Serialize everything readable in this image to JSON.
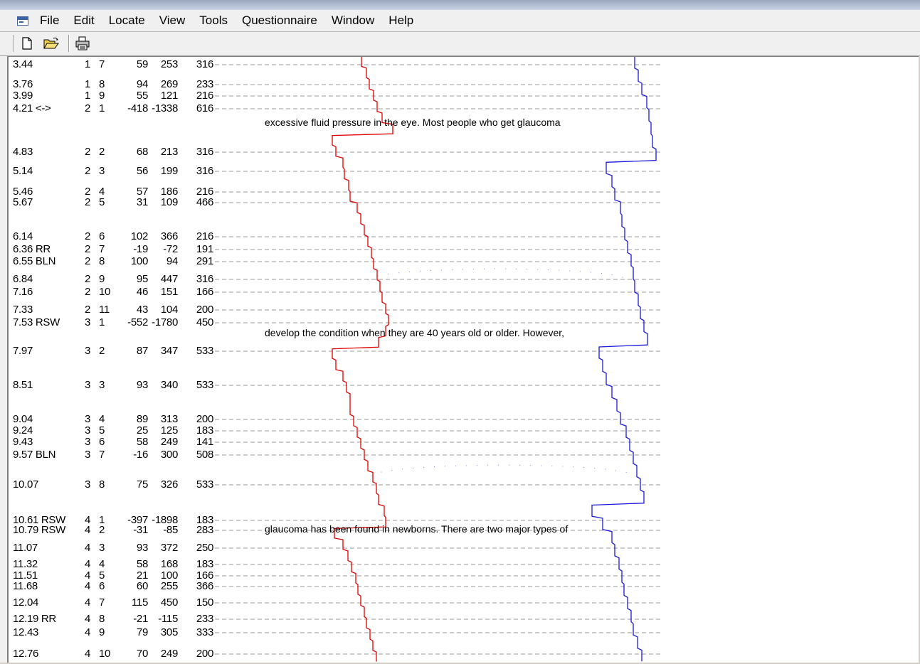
{
  "menu": [
    "File",
    "Edit",
    "Locate",
    "View",
    "Tools",
    "Questionnaire",
    "Window",
    "Help"
  ],
  "toolbar": {
    "icons": [
      "new-document-icon",
      "open-folder-icon",
      "print-icon"
    ]
  },
  "colors": {
    "left_trace": "#e00000",
    "right_trace": "#1a1adc",
    "dash": "#9a9a9a",
    "text": "#000000"
  },
  "rows": [
    {
      "time": "3.44",
      "a": "1",
      "b": "7",
      "c": "59",
      "d": "253",
      "e": "316"
    },
    {
      "time": "3.76",
      "a": "1",
      "b": "8",
      "c": "94",
      "d": "269",
      "e": "233"
    },
    {
      "time": "3.99",
      "a": "1",
      "b": "9",
      "c": "55",
      "d": "121",
      "e": "216"
    },
    {
      "time": "4.21 <->",
      "a": "2",
      "b": "1",
      "c": "-418",
      "d": "-1338",
      "e": "616"
    },
    {
      "time": "4.83",
      "a": "2",
      "b": "2",
      "c": "68",
      "d": "213",
      "e": "316"
    },
    {
      "time": "5.14",
      "a": "2",
      "b": "3",
      "c": "56",
      "d": "199",
      "e": "316"
    },
    {
      "time": "5.46",
      "a": "2",
      "b": "4",
      "c": "57",
      "d": "186",
      "e": "216"
    },
    {
      "time": "5.67",
      "a": "2",
      "b": "5",
      "c": "31",
      "d": "109",
      "e": "466"
    },
    {
      "time": "6.14",
      "a": "2",
      "b": "6",
      "c": "102",
      "d": "366",
      "e": "216"
    },
    {
      "time": "6.36 RR",
      "a": "2",
      "b": "7",
      "c": "-19",
      "d": "-72",
      "e": "191"
    },
    {
      "time": "6.55 BLN",
      "a": "2",
      "b": "8",
      "c": "100",
      "d": "94",
      "e": "291"
    },
    {
      "time": "6.84",
      "a": "2",
      "b": "9",
      "c": "95",
      "d": "447",
      "e": "316"
    },
    {
      "time": "7.16",
      "a": "2",
      "b": "10",
      "c": "46",
      "d": "151",
      "e": "166"
    },
    {
      "time": "7.33",
      "a": "2",
      "b": "11",
      "c": "43",
      "d": "104",
      "e": "200"
    },
    {
      "time": "7.53 RSW",
      "a": "3",
      "b": "1",
      "c": "-552",
      "d": "-1780",
      "e": "450"
    },
    {
      "time": "7.97",
      "a": "3",
      "b": "2",
      "c": "87",
      "d": "347",
      "e": "533"
    },
    {
      "time": "8.51",
      "a": "3",
      "b": "3",
      "c": "93",
      "d": "340",
      "e": "533"
    },
    {
      "time": "9.04",
      "a": "3",
      "b": "4",
      "c": "89",
      "d": "313",
      "e": "200"
    },
    {
      "time": "9.24",
      "a": "3",
      "b": "5",
      "c": "25",
      "d": "125",
      "e": "183"
    },
    {
      "time": "9.43",
      "a": "3",
      "b": "6",
      "c": "58",
      "d": "249",
      "e": "141"
    },
    {
      "time": "9.57 BLN",
      "a": "3",
      "b": "7",
      "c": "-16",
      "d": "300",
      "e": "508"
    },
    {
      "time": "10.07",
      "a": "3",
      "b": "8",
      "c": "75",
      "d": "326",
      "e": "533"
    },
    {
      "time": "10.61 RSW",
      "a": "4",
      "b": "1",
      "c": "-397",
      "d": "-1898",
      "e": "183"
    },
    {
      "time": "10.79 RSW",
      "a": "4",
      "b": "2",
      "c": "-31",
      "d": "-85",
      "e": "283"
    },
    {
      "time": "11.07",
      "a": "4",
      "b": "3",
      "c": "93",
      "d": "372",
      "e": "250"
    },
    {
      "time": "11.32",
      "a": "4",
      "b": "4",
      "c": "58",
      "d": "168",
      "e": "183"
    },
    {
      "time": "11.51",
      "a": "4",
      "b": "5",
      "c": "21",
      "d": "100",
      "e": "166"
    },
    {
      "time": "11.68",
      "a": "4",
      "b": "6",
      "c": "60",
      "d": "255",
      "e": "366"
    },
    {
      "time": "12.04",
      "a": "4",
      "b": "7",
      "c": "115",
      "d": "450",
      "e": "150"
    },
    {
      "time": "12.19 RR",
      "a": "4",
      "b": "8",
      "c": "-21",
      "d": "-115",
      "e": "233"
    },
    {
      "time": "12.43",
      "a": "4",
      "b": "9",
      "c": "79",
      "d": "305",
      "e": "333"
    },
    {
      "time": "12.76",
      "a": "4",
      "b": "10",
      "c": "70",
      "d": "249",
      "e": "200"
    }
  ],
  "sentences": [
    "excessive fluid pressure in the eye. Most people who get glaucoma",
    "develop the condition when they are 40 years old or older. However,",
    "glaucoma has been found in newborns. There are two major types of"
  ]
}
